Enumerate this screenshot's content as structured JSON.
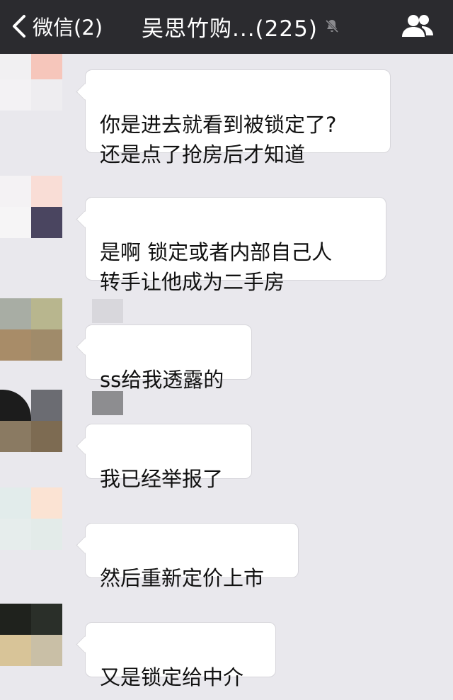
{
  "header": {
    "back_label": "微信(2)",
    "title": "吴思竹购...(225)",
    "icons": {
      "back": "chevron-left-icon",
      "mute": "bell-muted-icon",
      "group": "group-members-icon"
    }
  },
  "messages": [
    {
      "text": "你是进去就看到被锁定了?\n还是点了抢房后才知道"
    },
    {
      "text": "是啊  锁定或者内部自己人\n转手让他成为二手房"
    },
    {
      "text": "ss给我透露的"
    },
    {
      "text": "我已经举报了"
    },
    {
      "text": "然后重新定价上市"
    },
    {
      "text": "又是锁定给中介"
    }
  ],
  "colors": {
    "topbar": "#2b2b2f",
    "chat_background": "#e9e8ed",
    "bubble": "#ffffff"
  }
}
